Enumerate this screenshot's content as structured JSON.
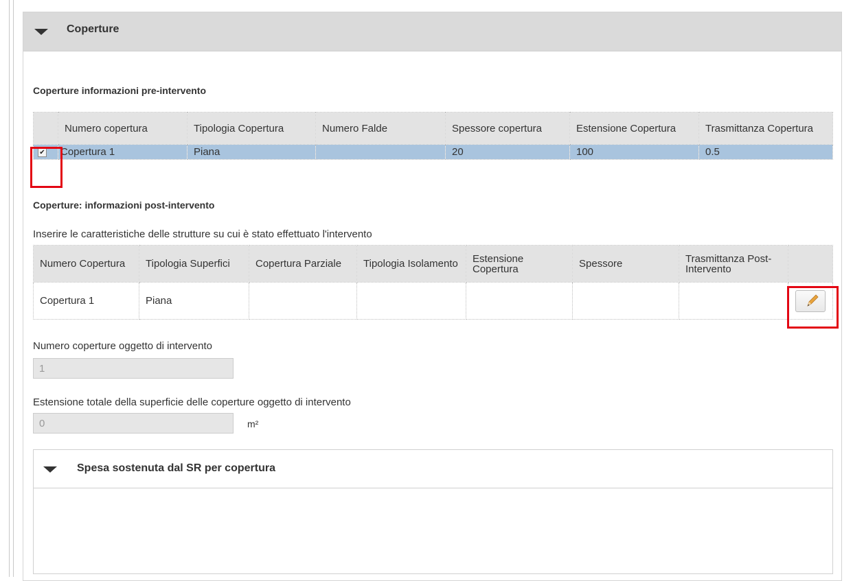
{
  "panel": {
    "title": "Coperture"
  },
  "pre": {
    "title": "Coperture informazioni pre-intervento",
    "columns": [
      "Numero copertura",
      "Tipologia Copertura",
      "Numero Falde",
      "Spessore copertura",
      "Estensione Copertura",
      "Trasmittanza Copertura"
    ],
    "rows": [
      {
        "selected": true,
        "checkbox": "✔",
        "cells": [
          "Copertura 1",
          "Piana",
          "",
          "20",
          "100",
          "0.5"
        ]
      }
    ]
  },
  "post": {
    "title": "Coperture: informazioni post-intervento",
    "instructions": "Inserire le caratteristiche delle strutture su cui è stato effettuato l'intervento",
    "columns": [
      "Numero Copertura",
      "Tipologia Superfici",
      "Copertura Parziale",
      "Tipologia Isolamento",
      "Estensione Copertura",
      "Spessore",
      "Trasmittanza Post-Intervento"
    ],
    "rows": [
      {
        "cells": [
          "Copertura 1",
          "Piana",
          "",
          "",
          "",
          "",
          ""
        ],
        "action_icon": "pencil-icon"
      }
    ]
  },
  "fields": {
    "numero_label": "Numero coperture oggetto di intervento",
    "numero_value": "1",
    "estensione_label": "Estensione totale della superficie delle coperture oggetto di intervento",
    "estensione_value": "0",
    "estensione_unit": "m²"
  },
  "spesa": {
    "title": "Spesa sostenuta dal SR per copertura"
  },
  "colors": {
    "header_bg": "#dadada",
    "selected_row": "#a9c4de",
    "highlight": "#e30613"
  }
}
